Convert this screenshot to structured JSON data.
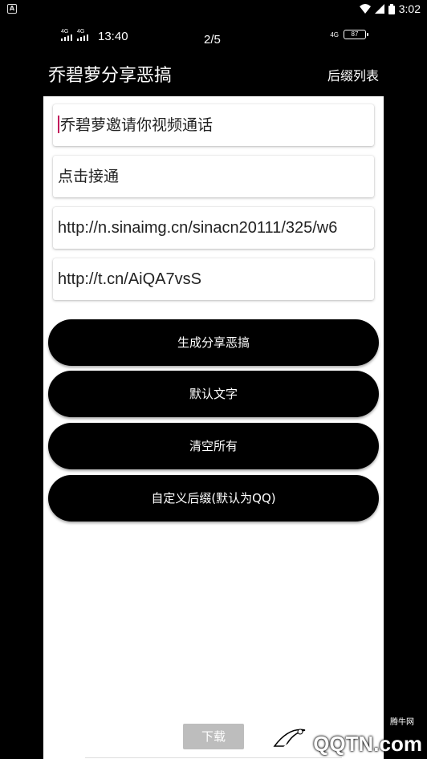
{
  "system_status": {
    "time": "3:02",
    "notification_letter": "A"
  },
  "inner_status": {
    "network_1": "4G",
    "network_2": "4G",
    "clock": "13:40",
    "page_indicator": "2/5",
    "right_network": "4G",
    "battery": "87"
  },
  "header": {
    "title": "乔碧萝分享恶搞",
    "menu_label": "后缀列表"
  },
  "form": {
    "fields": [
      {
        "value": "乔碧萝邀请你视频通话"
      },
      {
        "value": "点击接通"
      },
      {
        "value": "http://n.sinaimg.cn/sinacn20111/325/w6"
      },
      {
        "value": "http://t.cn/AiQA7vsS"
      }
    ]
  },
  "buttons": {
    "generate": "生成分享恶搞",
    "default_text": "默认文字",
    "clear_all": "清空所有",
    "custom_suffix": "自定义后缀(默认为QQ)",
    "download": "下载"
  },
  "watermark": {
    "text": "QQTN.com",
    "small": "腾牛网"
  }
}
